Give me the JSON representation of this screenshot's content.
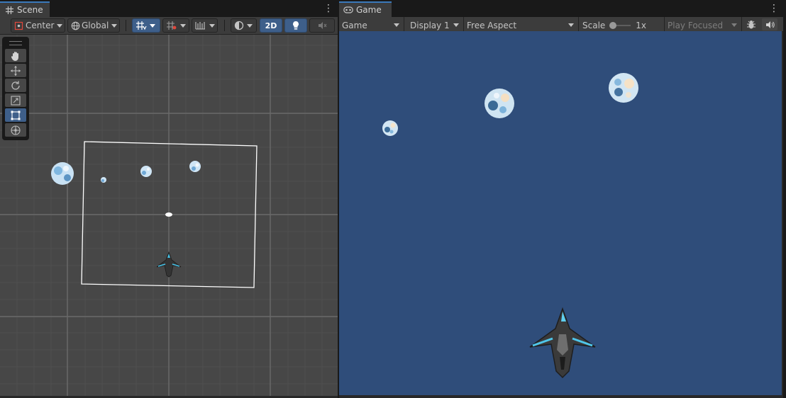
{
  "scene": {
    "tab_label": "Scene",
    "toolbar": {
      "pivot_label": "Center",
      "space_label": "Global",
      "mode_2d_label": "2D"
    }
  },
  "game": {
    "tab_label": "Game",
    "toolbar": {
      "view_label": "Game",
      "display_label": "Display 1",
      "aspect_label": "Free Aspect",
      "scale_label": "Scale",
      "scale_value": "1x",
      "play_mode_label": "Play Focused"
    }
  },
  "colors": {
    "editor_bg": "#282828",
    "scene_bg": "#474747",
    "game_bg": "#2f4d7a",
    "accent": "#3a79bb",
    "active_button": "#3e5f8a"
  }
}
